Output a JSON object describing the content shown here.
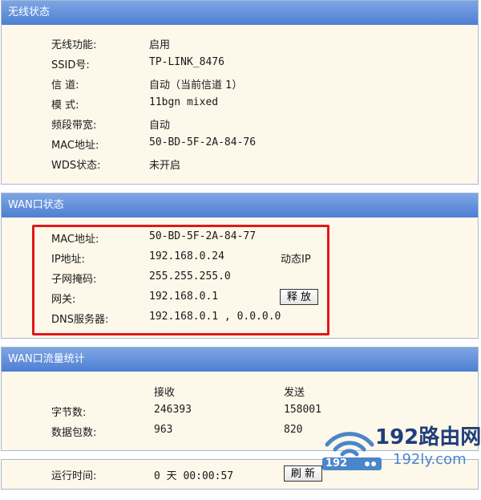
{
  "wireless_status": {
    "header": "无线状态",
    "rows": [
      {
        "label": "无线功能:",
        "value": "启用"
      },
      {
        "label": "SSID号:",
        "value": "TP-LINK_8476"
      },
      {
        "label": "信 道:",
        "value": "自动（当前信道 1）"
      },
      {
        "label": "模 式:",
        "value": "11bgn mixed"
      },
      {
        "label": "频段带宽:",
        "value": "自动"
      },
      {
        "label": "MAC地址:",
        "value": "50-BD-5F-2A-84-76"
      },
      {
        "label": "WDS状态:",
        "value": "未开启"
      }
    ]
  },
  "wan_status": {
    "header": "WAN口状态",
    "rows": [
      {
        "label": "MAC地址:",
        "value": "50-BD-5F-2A-84-77"
      },
      {
        "label": "IP地址:",
        "value": "192.168.0.24"
      },
      {
        "label": "子网掩码:",
        "value": "255.255.255.0"
      },
      {
        "label": "网关:",
        "value": "192.168.0.1"
      },
      {
        "label": "DNS服务器:",
        "value": "192.168.0.1 , 0.0.0.0"
      }
    ],
    "ip_type": "动态IP",
    "release_button": "释 放"
  },
  "wan_traffic": {
    "header": "WAN口流量统计",
    "col_receive": "接收",
    "col_send": "发送",
    "rows": [
      {
        "label": "字节数:",
        "receive": "246393",
        "send": "158001"
      },
      {
        "label": "数据包数:",
        "receive": "963",
        "send": "820"
      }
    ]
  },
  "uptime": {
    "label": "运行时间:",
    "value": "0 天 00:00:57",
    "refresh_button": "刷 新"
  },
  "watermark": {
    "brand": "192路由网",
    "url": "192ly.com",
    "logo_text": "192"
  },
  "colors": {
    "header_top": "#7fa6e4",
    "header_bottom": "#4d7fd3",
    "panel_bg": "#fdf8ea",
    "highlight": "#e01818"
  }
}
